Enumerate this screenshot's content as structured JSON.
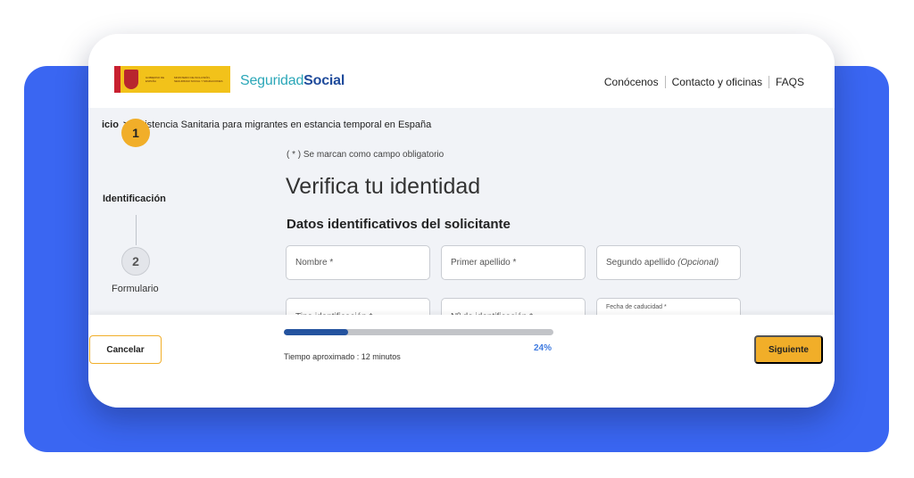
{
  "header": {
    "brand_light": "Seguridad",
    "brand_bold": "Social",
    "gov_logo_text": "GOBIERNO DE ESPAÑA",
    "ministry_text": "MINISTERIO DE INCLUSIÓN, SEGURIDAD SOCIAL Y MIGRACIONES",
    "nav": [
      "Conócenos",
      "Contacto y oficinas",
      "FAQS"
    ]
  },
  "breadcrumb": {
    "first": "icio",
    "separator": ">",
    "current": "Asistencia Sanitaria para migrantes en estancia temporal en España"
  },
  "steps": [
    {
      "number": "1",
      "label": "Identificación",
      "state": "active"
    },
    {
      "number": "2",
      "label": "Formulario",
      "state": "pending"
    }
  ],
  "form": {
    "required_note": "( * ) Se marcan como campo obligatorio",
    "title": "Verifica tu identidad",
    "section_title": "Datos identificativos del solicitante",
    "fields": {
      "nombre": "Nombre *",
      "primer_apellido": "Primer apellido *",
      "segundo_apellido": "Segundo apellido",
      "segundo_apellido_hint": "(Opcional)",
      "tipo_identificacion": "Tipo identificación *",
      "numero_identificacion": "Nº de identificación *",
      "fecha_caducidad": "Fecha de caducidad *"
    }
  },
  "footer": {
    "cancel_label": "Cancelar",
    "next_label": "Siguiente",
    "progress_percent_label": "24%",
    "progress_value": 0.24,
    "time_estimate": "Tiempo aproximado : 12 minutos"
  },
  "colors": {
    "background_blue": "#3a66f2",
    "accent_yellow": "#f1ae29",
    "progress_blue": "#24539f",
    "brand_teal": "#2ba7b8",
    "brand_navy": "#1f4b9b"
  }
}
